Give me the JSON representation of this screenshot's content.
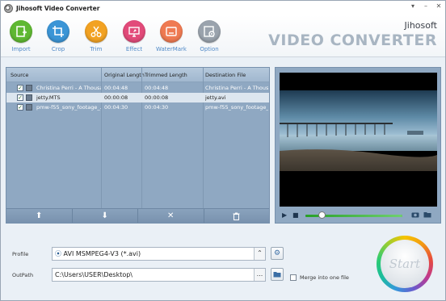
{
  "window": {
    "title": "Jihosoft Video Converter",
    "controls": [
      "▾",
      "–",
      "✕"
    ]
  },
  "brand": {
    "line1": "Jihosoft",
    "line2": "VIDEO CONVERTER"
  },
  "toolbar": [
    {
      "label": "Import",
      "color": "#5fb832",
      "icon": "import-icon"
    },
    {
      "label": "Crop",
      "color": "#3b95d6",
      "icon": "crop-icon"
    },
    {
      "label": "Trim",
      "color": "#f2a223",
      "icon": "scissors-icon"
    },
    {
      "label": "Effect",
      "color": "#e24b7a",
      "icon": "effect-icon"
    },
    {
      "label": "WaterMark",
      "color": "#ef7a52",
      "icon": "watermark-icon"
    },
    {
      "label": "Option",
      "color": "#9aa3ad",
      "icon": "gear-icon"
    }
  ],
  "list": {
    "columns": [
      "Source",
      "Original Length",
      "Trimmed Length",
      "Destination File"
    ],
    "rows": [
      {
        "source": "Christina Perri - A Thousa...",
        "original": "00:04:48",
        "trimmed": "00:04:48",
        "destination": "Christina Perri - A Thous...",
        "checked": true,
        "selected": false
      },
      {
        "source": "jetty.MTS",
        "original": "00:00:08",
        "trimmed": "00:00:08",
        "destination": "jetty.avi",
        "checked": true,
        "selected": true
      },
      {
        "source": "pmw-f55_sony_footage_...",
        "original": "00:04:30",
        "trimmed": "00:04:30",
        "destination": "pmw-f55_sony_footage_...",
        "checked": true,
        "selected": false
      }
    ],
    "footer_buttons": [
      {
        "name": "move-up-button",
        "icon": "arrow-up-icon",
        "glyph": "⬆"
      },
      {
        "name": "move-down-button",
        "icon": "arrow-down-icon",
        "glyph": "⬇"
      },
      {
        "name": "remove-button",
        "icon": "close-icon",
        "glyph": "✕"
      },
      {
        "name": "clear-button",
        "icon": "trash-icon",
        "glyph": "🗑"
      }
    ]
  },
  "player": {
    "play": "▶",
    "stop": "■",
    "progress": 0.17
  },
  "profile": {
    "label": "Profile",
    "value": "AVI MSMPEG4-V3 (*.avi)"
  },
  "output": {
    "label": "OutPath",
    "value": "C:\\Users\\USER\\Desktop\\",
    "browse": "..."
  },
  "merge": {
    "label": "Merge into one file",
    "checked": false
  },
  "start": {
    "label": "Start"
  }
}
